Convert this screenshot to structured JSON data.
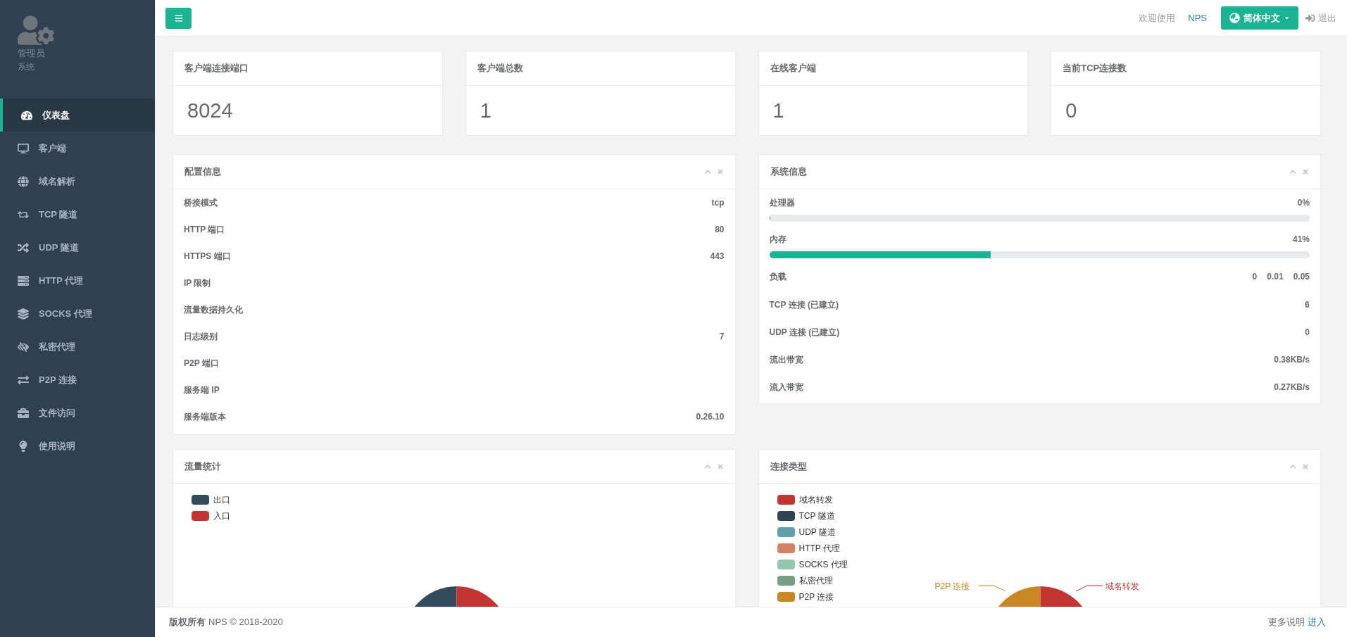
{
  "user": {
    "name": "管理员",
    "role": "系统"
  },
  "sidebar": {
    "items": [
      {
        "label": "仪表盘",
        "selected": true
      },
      {
        "label": "客户端",
        "selected": false
      },
      {
        "label": "域名解析",
        "selected": false
      },
      {
        "label": "TCP 隧道",
        "selected": false
      },
      {
        "label": "UDP 隧道",
        "selected": false
      },
      {
        "label": "HTTP 代理",
        "selected": false
      },
      {
        "label": "SOCKS 代理",
        "selected": false
      },
      {
        "label": "私密代理",
        "selected": false
      },
      {
        "label": "P2P 连接",
        "selected": false
      },
      {
        "label": "文件访问",
        "selected": false
      },
      {
        "label": "使用说明",
        "selected": false
      }
    ]
  },
  "topbar": {
    "welcome": "欢迎使用",
    "brand": "NPS",
    "language": "简体中文",
    "logout": "退出"
  },
  "stats": [
    {
      "title": "客户端连接端口",
      "value": "8024"
    },
    {
      "title": "客户端总数",
      "value": "1"
    },
    {
      "title": "在线客户端",
      "value": "1"
    },
    {
      "title": "当前TCP连接数",
      "value": "0"
    }
  ],
  "config_panel": {
    "title": "配置信息",
    "rows": [
      {
        "label": "桥接模式",
        "value": "tcp"
      },
      {
        "label": "HTTP 端口",
        "value": "80"
      },
      {
        "label": "HTTPS 端口",
        "value": "443"
      },
      {
        "label": "IP 限制"
      },
      {
        "label": "流量数据持久化"
      },
      {
        "label": "日志级别",
        "value": "7"
      },
      {
        "label": "P2P 端口"
      },
      {
        "label": "服务端 IP"
      },
      {
        "label": "服务端版本",
        "value": "0.26.10"
      }
    ]
  },
  "system_panel": {
    "title": "系统信息",
    "rows": [
      {
        "kind": "meter",
        "label": "处理器",
        "value": "0%",
        "level": 0
      },
      {
        "kind": "meter",
        "label": "内存",
        "value": "41%",
        "level": 0.41
      },
      {
        "kind": "load",
        "label": "负载",
        "values": [
          "0",
          "0.01",
          "0.05"
        ]
      },
      {
        "kind": "text",
        "label": "TCP 连接 (已建立)",
        "value": "6"
      },
      {
        "kind": "text",
        "label": "UDP 连接 (已建立)",
        "value": "0"
      },
      {
        "kind": "text",
        "label": "流出带宽",
        "value": "0.38KB/s"
      },
      {
        "kind": "text",
        "label": "流入带宽",
        "value": "0.27KB/s"
      }
    ]
  },
  "traffic_panel": {
    "title": "流量统计",
    "legend": [
      {
        "label": "出口",
        "color": "#334b5c"
      },
      {
        "label": "入口",
        "color": "#c23531"
      }
    ]
  },
  "connection_panel": {
    "title": "连接类型",
    "legend": [
      {
        "label": "域名转发",
        "color": "#c23531"
      },
      {
        "label": "TCP 隧道",
        "color": "#2f4554"
      },
      {
        "label": "UDP 隧道",
        "color": "#61a0a8"
      },
      {
        "label": "HTTP 代理",
        "color": "#d48265"
      },
      {
        "label": "SOCKS 代理",
        "color": "#91c7ae"
      },
      {
        "label": "私密代理",
        "color": "#749f83"
      },
      {
        "label": "P2P 连接",
        "color": "#ca8622"
      }
    ],
    "slice_labels": [
      "P2P 连接",
      "域名转发"
    ]
  },
  "footer": {
    "owner": "版权所有",
    "copyright": "NPS © 2018-2020",
    "more": "更多说明",
    "link": "进入"
  }
}
